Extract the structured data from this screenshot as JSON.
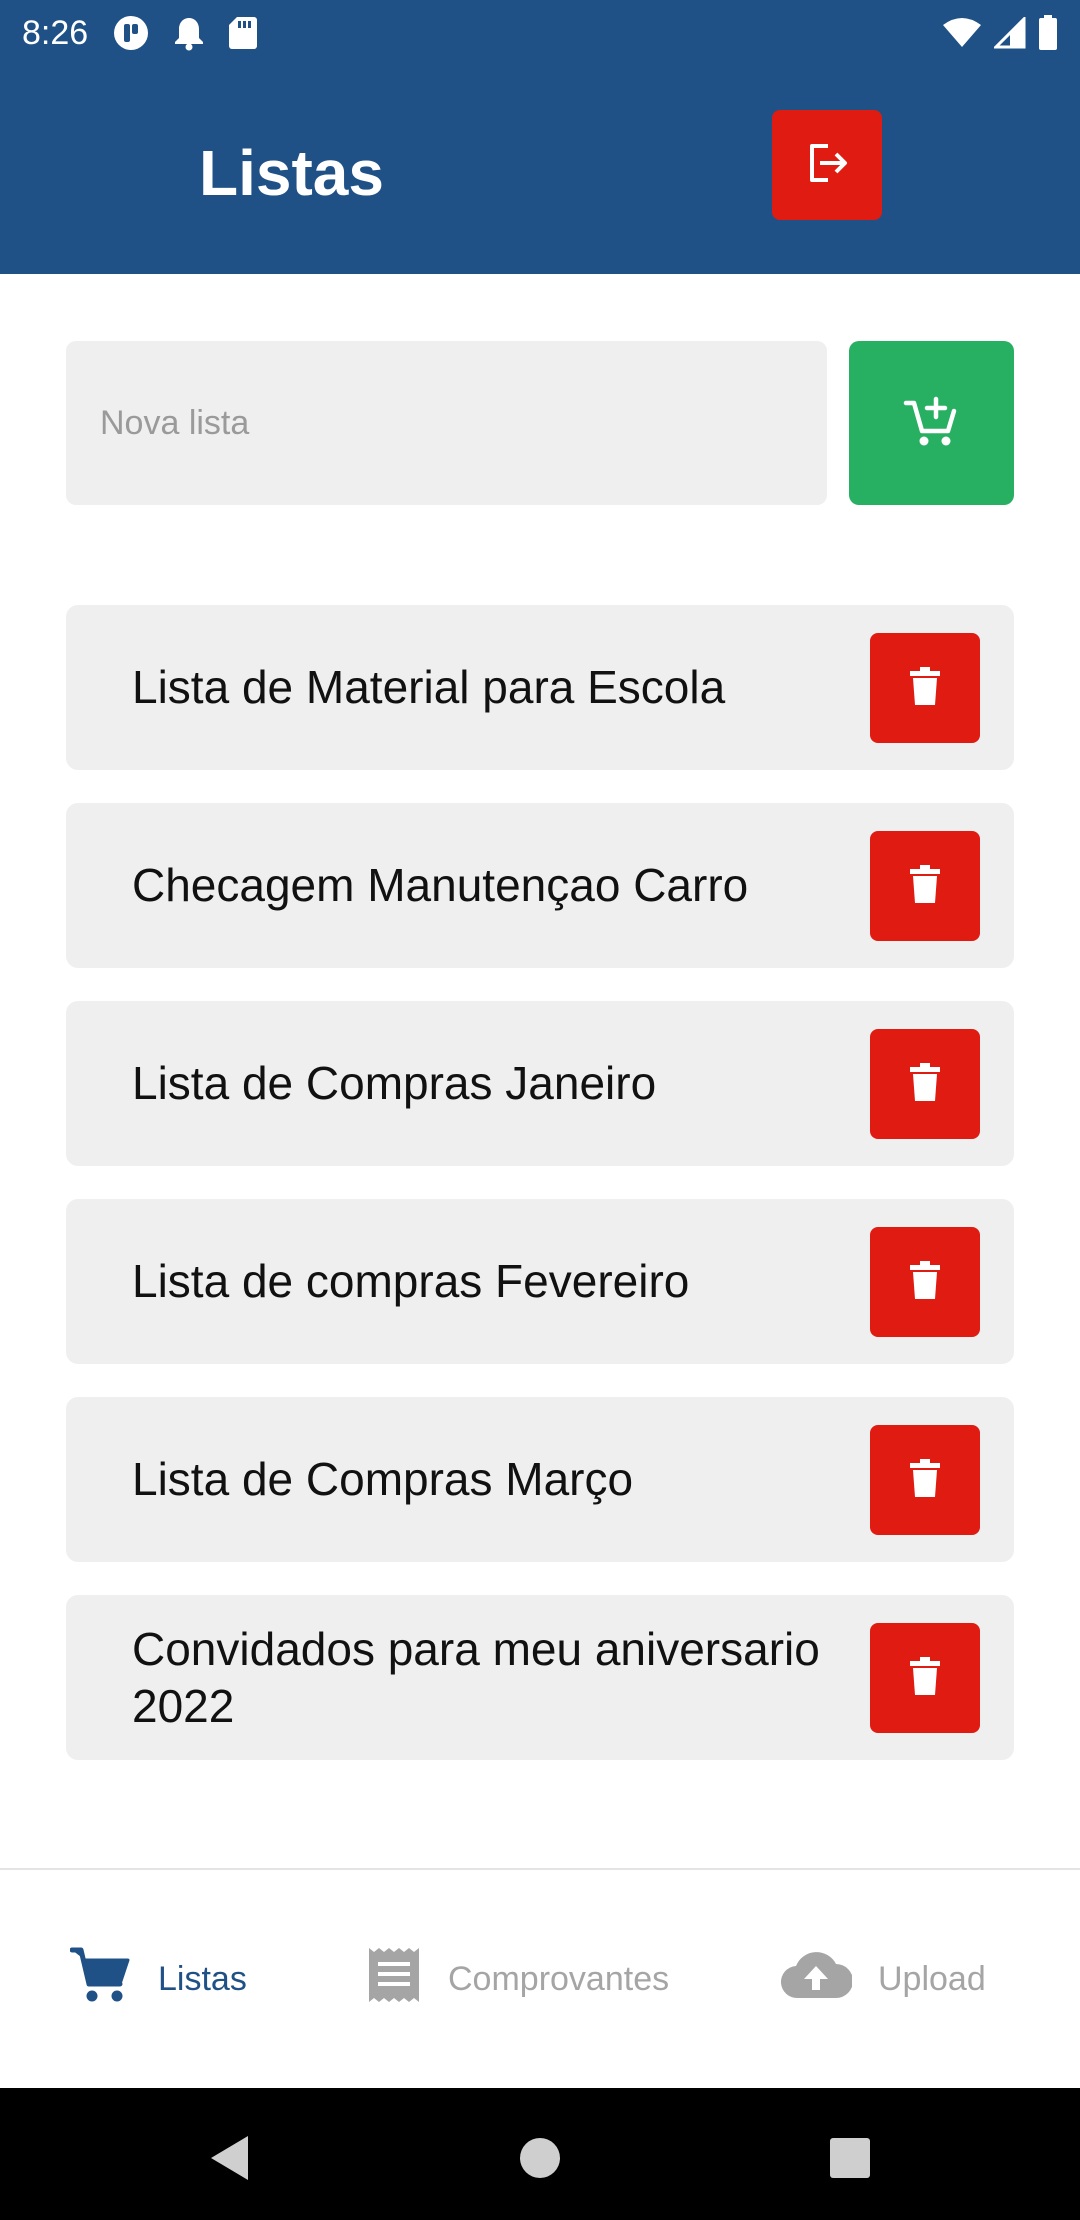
{
  "status_bar": {
    "time": "8:26",
    "icons_left": [
      "app-notification-icon",
      "bell-icon",
      "sd-card-icon"
    ],
    "icons_right": [
      "wifi-icon",
      "cell-signal-icon",
      "battery-icon"
    ]
  },
  "app_bar": {
    "title": "Listas",
    "logout_icon": "logout-icon",
    "logout_color": "#e01b12",
    "background": "#1f5187"
  },
  "new_list": {
    "placeholder": "Nova lista",
    "value": "",
    "add_icon": "add-to-cart-icon",
    "add_color": "#28b062"
  },
  "lists": [
    {
      "label": "Lista de Material para Escola"
    },
    {
      "label": "Checagem Manutençao Carro"
    },
    {
      "label": "Lista de Compras Janeiro"
    },
    {
      "label": "Lista de compras Fevereiro"
    },
    {
      "label": "Lista de Compras Março"
    },
    {
      "label": "Convidados para meu aniversario 2022"
    }
  ],
  "bottom_nav": {
    "items": [
      {
        "label": "Listas",
        "icon": "shopping-cart-icon",
        "active": true
      },
      {
        "label": "Comprovantes",
        "icon": "receipt-icon",
        "active": false
      },
      {
        "label": "Upload",
        "icon": "cloud-upload-icon",
        "active": false
      }
    ],
    "active_color": "#1f5187",
    "inactive_color": "#a5a5a5"
  },
  "system_nav": [
    "back-icon",
    "home-icon",
    "recents-icon"
  ]
}
